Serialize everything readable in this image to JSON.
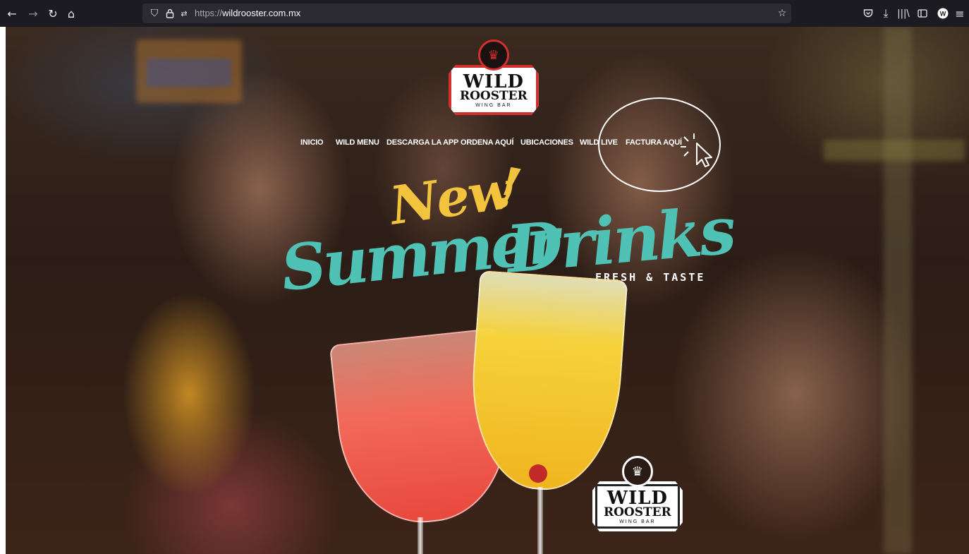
{
  "browser": {
    "url_scheme": "https://",
    "url_host": "wildrooster.com.mx",
    "icons": {
      "back": "arrow-left-icon",
      "forward": "arrow-right-icon",
      "reload": "reload-icon",
      "home": "home-icon",
      "shield": "shield-icon",
      "lock": "lock-icon",
      "permissions": "permissions-icon",
      "bookmark": "star-icon",
      "pocket": "pocket-icon",
      "downloads": "download-icon",
      "library": "library-icon",
      "sidebar": "sidebar-icon",
      "account": "account-icon",
      "menu": "hamburger-menu-icon"
    }
  },
  "logo": {
    "line1": "WILD",
    "line2": "ROOSTER",
    "line3": "WING BAR"
  },
  "nav": {
    "items": [
      {
        "label": "INICIO"
      },
      {
        "label": "WILD MENU"
      },
      {
        "label": "DESCARGA LA APP"
      },
      {
        "label": "ORDENA AQUÍ"
      },
      {
        "label": "UBICACIONES"
      },
      {
        "label": "WILD LIVE"
      },
      {
        "label": "FACTURA AQUÍ"
      }
    ]
  },
  "hero": {
    "new": "New",
    "exclaim": "!",
    "summer": "Summer",
    "drinks": "Drinks",
    "tagline": "FRESH & TASTE"
  },
  "colors": {
    "brand_red": "#d32f2f",
    "headline_yellow": "#f2c33c",
    "headline_teal": "#4fc2b5",
    "chrome_bg": "#1c1b22",
    "urlbar_bg": "#2b2a33"
  }
}
